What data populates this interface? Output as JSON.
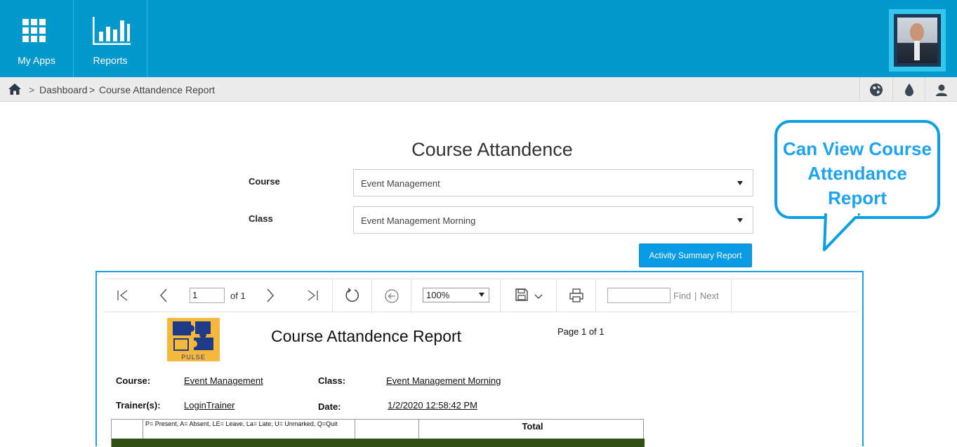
{
  "topbar": {
    "tiles": [
      {
        "label": "My Apps",
        "icon": "apps-grid-icon"
      },
      {
        "label": "Reports",
        "icon": "bar-chart-icon"
      }
    ],
    "brand_color": "#0399cc"
  },
  "breadcrumb": {
    "separator1": ">",
    "dashboard": "Dashboard",
    "separator2": ">",
    "current": "Course Attandence Report"
  },
  "page": {
    "title": "Course Attandence",
    "course_label": "Course",
    "course_value": "Event Management",
    "class_label": "Class",
    "class_value": "Event Management Morning",
    "activity_button": "Activity Summary Report"
  },
  "callout": {
    "line1": "Can View Course",
    "line2": "Attendance",
    "line3": "Report",
    "color": "#1ea3ee"
  },
  "viewer": {
    "page_input": "1",
    "of_text": "of 1",
    "zoom": "100%",
    "find_label": "Find",
    "find_sep": "|",
    "next_label": "Next"
  },
  "report": {
    "logo_text": "PULSE",
    "title": "Course Attandence Report",
    "page_of": "Page 1 of 1",
    "course_label": "Course:",
    "course_value": "Event Management",
    "class_label": "Class:",
    "class_value": "Event Management Morning",
    "trainer_label": "Trainer(s):",
    "trainer_value": "LoginTrainer",
    "date_label": "Date:",
    "date_value": "1/2/2020 12:58:42 PM",
    "legend": "P= Present, A= Absent, LE= Leave, La= Late, U= Unmarked, Q=Quit",
    "total_header": "Total"
  }
}
